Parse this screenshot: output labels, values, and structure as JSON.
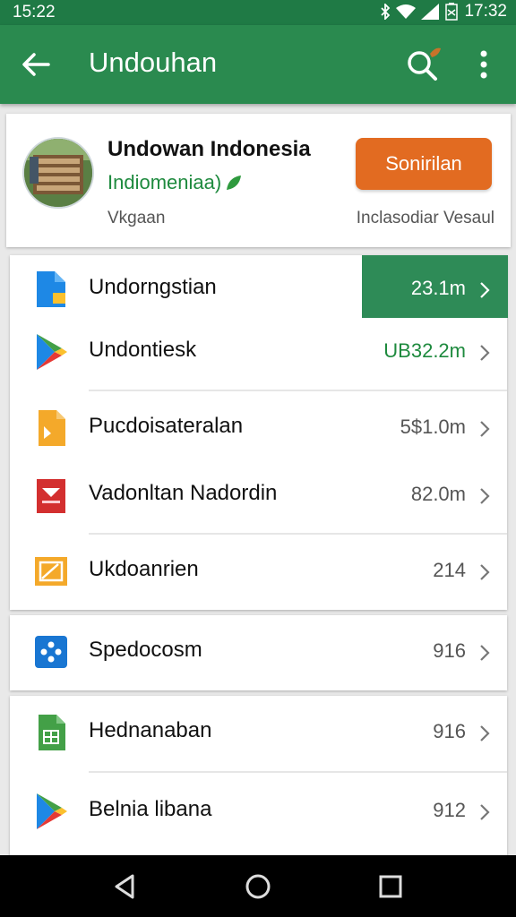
{
  "status_bar": {
    "time_left": "15:22",
    "time_right": "17:32"
  },
  "app_bar": {
    "title": "Undouhan"
  },
  "header_card": {
    "title": "Undowan Indonesia",
    "subtitle": "Indiomeniaa)",
    "meta_left": "Vkgaan",
    "meta_right": "Inclasodiar Vesaul",
    "button_label": "Sonirilan"
  },
  "group1": {
    "items": [
      {
        "label": "Undorngstian",
        "value": "23.1m",
        "icon": "document-icon"
      },
      {
        "label": "Undontiesk",
        "value": "UB32.2m",
        "icon": "play-store-icon"
      },
      {
        "label": "Pucdoisateralan",
        "value": "5$1.0m",
        "icon": "slides-icon"
      },
      {
        "label": "Vadonltan Nadordin",
        "value": "82.0m",
        "icon": "mail-doc-icon"
      },
      {
        "label": "Ukdoanrien",
        "value": "214",
        "icon": "image-icon"
      }
    ]
  },
  "group2": {
    "items": [
      {
        "label": "Spedocosm",
        "value": "916",
        "icon": "photos-icon"
      }
    ]
  },
  "group3": {
    "items": [
      {
        "label": "Hednanaban",
        "value": "916",
        "icon": "sheets-icon"
      },
      {
        "label": "Belnia libana",
        "value": "912",
        "icon": "play-store-icon"
      }
    ]
  },
  "colors": {
    "primary": "#2a8a4f",
    "status": "#1f7a45",
    "accent": "#e26b21",
    "highlight": "#2e8b57",
    "value_green": "#1e8a3e"
  }
}
